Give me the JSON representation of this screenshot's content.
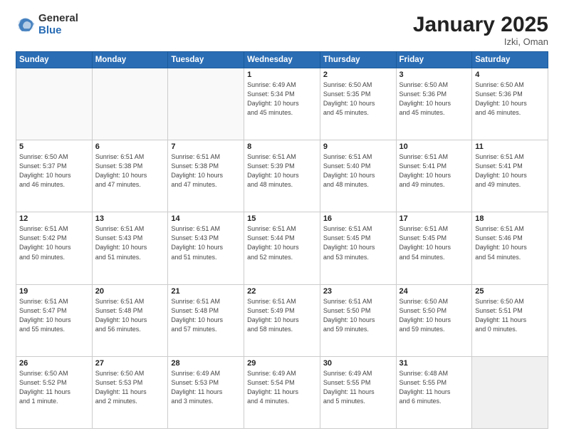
{
  "header": {
    "logo_general": "General",
    "logo_blue": "Blue",
    "month_title": "January 2025",
    "subtitle": "Izki, Oman"
  },
  "weekdays": [
    "Sunday",
    "Monday",
    "Tuesday",
    "Wednesday",
    "Thursday",
    "Friday",
    "Saturday"
  ],
  "weeks": [
    [
      {
        "day": "",
        "info": ""
      },
      {
        "day": "",
        "info": ""
      },
      {
        "day": "",
        "info": ""
      },
      {
        "day": "1",
        "info": "Sunrise: 6:49 AM\nSunset: 5:34 PM\nDaylight: 10 hours\nand 45 minutes."
      },
      {
        "day": "2",
        "info": "Sunrise: 6:50 AM\nSunset: 5:35 PM\nDaylight: 10 hours\nand 45 minutes."
      },
      {
        "day": "3",
        "info": "Sunrise: 6:50 AM\nSunset: 5:36 PM\nDaylight: 10 hours\nand 45 minutes."
      },
      {
        "day": "4",
        "info": "Sunrise: 6:50 AM\nSunset: 5:36 PM\nDaylight: 10 hours\nand 46 minutes."
      }
    ],
    [
      {
        "day": "5",
        "info": "Sunrise: 6:50 AM\nSunset: 5:37 PM\nDaylight: 10 hours\nand 46 minutes."
      },
      {
        "day": "6",
        "info": "Sunrise: 6:51 AM\nSunset: 5:38 PM\nDaylight: 10 hours\nand 47 minutes."
      },
      {
        "day": "7",
        "info": "Sunrise: 6:51 AM\nSunset: 5:38 PM\nDaylight: 10 hours\nand 47 minutes."
      },
      {
        "day": "8",
        "info": "Sunrise: 6:51 AM\nSunset: 5:39 PM\nDaylight: 10 hours\nand 48 minutes."
      },
      {
        "day": "9",
        "info": "Sunrise: 6:51 AM\nSunset: 5:40 PM\nDaylight: 10 hours\nand 48 minutes."
      },
      {
        "day": "10",
        "info": "Sunrise: 6:51 AM\nSunset: 5:41 PM\nDaylight: 10 hours\nand 49 minutes."
      },
      {
        "day": "11",
        "info": "Sunrise: 6:51 AM\nSunset: 5:41 PM\nDaylight: 10 hours\nand 49 minutes."
      }
    ],
    [
      {
        "day": "12",
        "info": "Sunrise: 6:51 AM\nSunset: 5:42 PM\nDaylight: 10 hours\nand 50 minutes."
      },
      {
        "day": "13",
        "info": "Sunrise: 6:51 AM\nSunset: 5:43 PM\nDaylight: 10 hours\nand 51 minutes."
      },
      {
        "day": "14",
        "info": "Sunrise: 6:51 AM\nSunset: 5:43 PM\nDaylight: 10 hours\nand 51 minutes."
      },
      {
        "day": "15",
        "info": "Sunrise: 6:51 AM\nSunset: 5:44 PM\nDaylight: 10 hours\nand 52 minutes."
      },
      {
        "day": "16",
        "info": "Sunrise: 6:51 AM\nSunset: 5:45 PM\nDaylight: 10 hours\nand 53 minutes."
      },
      {
        "day": "17",
        "info": "Sunrise: 6:51 AM\nSunset: 5:45 PM\nDaylight: 10 hours\nand 54 minutes."
      },
      {
        "day": "18",
        "info": "Sunrise: 6:51 AM\nSunset: 5:46 PM\nDaylight: 10 hours\nand 54 minutes."
      }
    ],
    [
      {
        "day": "19",
        "info": "Sunrise: 6:51 AM\nSunset: 5:47 PM\nDaylight: 10 hours\nand 55 minutes."
      },
      {
        "day": "20",
        "info": "Sunrise: 6:51 AM\nSunset: 5:48 PM\nDaylight: 10 hours\nand 56 minutes."
      },
      {
        "day": "21",
        "info": "Sunrise: 6:51 AM\nSunset: 5:48 PM\nDaylight: 10 hours\nand 57 minutes."
      },
      {
        "day": "22",
        "info": "Sunrise: 6:51 AM\nSunset: 5:49 PM\nDaylight: 10 hours\nand 58 minutes."
      },
      {
        "day": "23",
        "info": "Sunrise: 6:51 AM\nSunset: 5:50 PM\nDaylight: 10 hours\nand 59 minutes."
      },
      {
        "day": "24",
        "info": "Sunrise: 6:50 AM\nSunset: 5:50 PM\nDaylight: 10 hours\nand 59 minutes."
      },
      {
        "day": "25",
        "info": "Sunrise: 6:50 AM\nSunset: 5:51 PM\nDaylight: 11 hours\nand 0 minutes."
      }
    ],
    [
      {
        "day": "26",
        "info": "Sunrise: 6:50 AM\nSunset: 5:52 PM\nDaylight: 11 hours\nand 1 minute."
      },
      {
        "day": "27",
        "info": "Sunrise: 6:50 AM\nSunset: 5:53 PM\nDaylight: 11 hours\nand 2 minutes."
      },
      {
        "day": "28",
        "info": "Sunrise: 6:49 AM\nSunset: 5:53 PM\nDaylight: 11 hours\nand 3 minutes."
      },
      {
        "day": "29",
        "info": "Sunrise: 6:49 AM\nSunset: 5:54 PM\nDaylight: 11 hours\nand 4 minutes."
      },
      {
        "day": "30",
        "info": "Sunrise: 6:49 AM\nSunset: 5:55 PM\nDaylight: 11 hours\nand 5 minutes."
      },
      {
        "day": "31",
        "info": "Sunrise: 6:48 AM\nSunset: 5:55 PM\nDaylight: 11 hours\nand 6 minutes."
      },
      {
        "day": "",
        "info": ""
      }
    ]
  ]
}
